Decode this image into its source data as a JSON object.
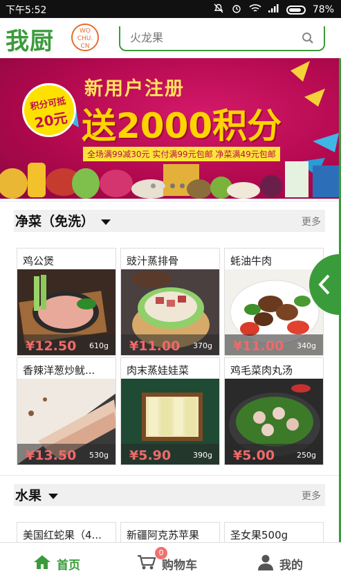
{
  "status_bar": {
    "time": "下午5:52",
    "battery": "78%"
  },
  "header": {
    "logo_text": "我厨",
    "logo_badge": [
      "WO",
      "CHU.",
      "CN"
    ],
    "search_placeholder": "火龙果"
  },
  "banner": {
    "badge_line1": "积分可抵",
    "badge_line2": "20元",
    "title": "新用户注册",
    "headline": "送2000积分",
    "subline": "全场满99减30元  实付满99元包邮  净菜满49元包邮"
  },
  "sections": [
    {
      "title": "净菜（免洗）",
      "more": "更多",
      "items": [
        {
          "name": "鸡公煲",
          "price": "¥12.50",
          "weight": "610g"
        },
        {
          "name": "豉汁蒸排骨",
          "price": "¥11.00",
          "weight": "370g"
        },
        {
          "name": "蚝油牛肉",
          "price": "¥11.00",
          "weight": "340g"
        },
        {
          "name": "香辣洋葱炒鱿...",
          "price": "¥13.50",
          "weight": "530g"
        },
        {
          "name": "肉末蒸娃娃菜",
          "price": "¥5.90",
          "weight": "390g"
        },
        {
          "name": "鸡毛菜肉丸汤",
          "price": "¥5.00",
          "weight": "250g"
        }
      ]
    },
    {
      "title": "水果",
      "more": "更多",
      "items": [
        {
          "name": "美国红蛇果（4..."
        },
        {
          "name": "新疆阿克苏苹果"
        },
        {
          "name": "圣女果500g"
        }
      ]
    }
  ],
  "bottom_nav": {
    "home": "首页",
    "cart": "购物车",
    "cart_count": "0",
    "me": "我的"
  },
  "colors": {
    "brand_green": "#3a9b3a",
    "price_red": "#f06a6a",
    "banner_magenta": "#c3105a"
  }
}
